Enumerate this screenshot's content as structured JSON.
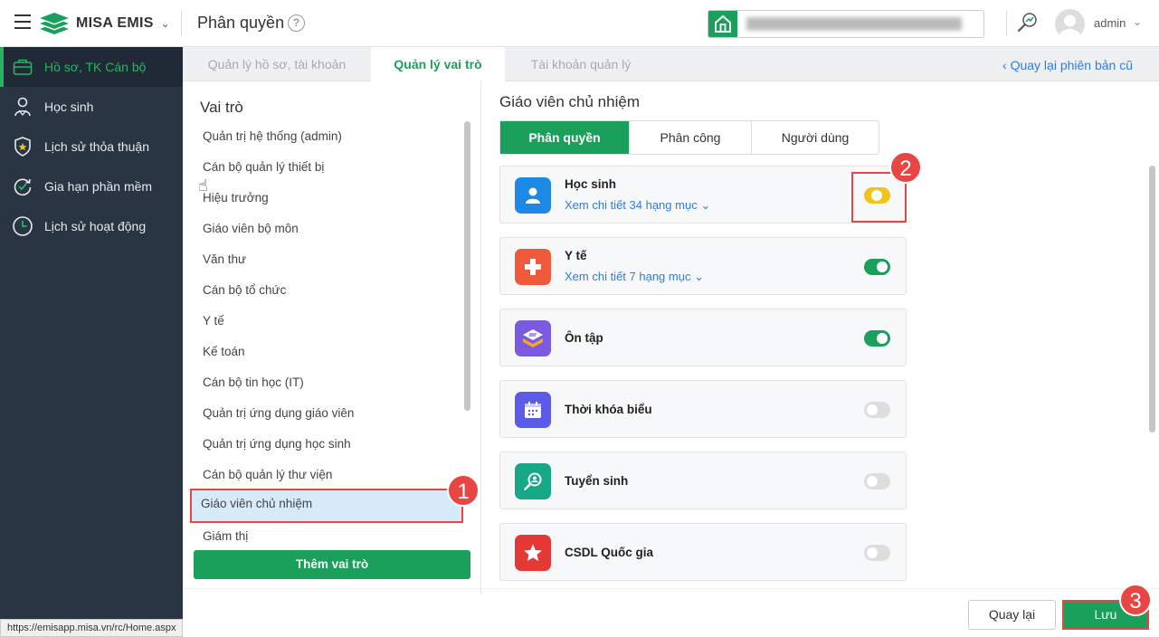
{
  "header": {
    "logo_text": "MISA EMIS",
    "page_title": "Phân quyền",
    "help": "?",
    "user_name": "admin"
  },
  "sidebar": {
    "items": [
      {
        "label": "Hồ sơ, TK Cán bộ",
        "icon": "briefcase-icon",
        "active": true
      },
      {
        "label": "Học sinh",
        "icon": "student-icon"
      },
      {
        "label": "Lịch sử thỏa thuận",
        "icon": "shield-star-icon"
      },
      {
        "label": "Gia hạn phần mềm",
        "icon": "renew-icon"
      },
      {
        "label": "Lịch sử hoạt động",
        "icon": "clock-icon"
      }
    ]
  },
  "tabs": [
    {
      "label": "Quản lý hồ sơ, tài khoản"
    },
    {
      "label": "Quản lý vai trò",
      "active": true
    },
    {
      "label": "Tài khoản quản lý"
    }
  ],
  "back_link": "‹ Quay lại phiên bản cũ",
  "roles": {
    "title": "Vai trò",
    "items": [
      "Quản trị hệ thống (admin)",
      "Cán bộ quản lý thiết bị",
      "Hiệu trưởng",
      "Giáo viên bộ môn",
      "Văn thư",
      "Cán bộ tổ chức",
      "Y tế",
      "Kế toán",
      "Cán bộ tin học (IT)",
      "Quản trị ứng dụng giáo viên",
      "Quản trị ứng dụng học sinh",
      "Cán bộ quản lý thư viện",
      "Giáo viên chủ nhiệm",
      "Giám thị"
    ],
    "selected": "Giáo viên chủ nhiệm",
    "add_button": "Thêm vai trò"
  },
  "permission": {
    "title": "Giáo viên chủ nhiệm",
    "segments": [
      "Phân quyền",
      "Phân công",
      "Người dùng"
    ],
    "active_segment": "Phân quyền",
    "modules": [
      {
        "name": "Học sinh",
        "detail": "Xem chi tiết 34 hạng mục",
        "state": "toggling",
        "icon": "person-icon",
        "color": "#1e88e5"
      },
      {
        "name": "Y tế",
        "detail": "Xem chi tiết 7 hạng mục",
        "state": "on",
        "icon": "medical-cross-icon",
        "color": "#ef5a3c"
      },
      {
        "name": "Ôn tập",
        "detail": "",
        "state": "on",
        "icon": "study-book-icon",
        "color": "#7a5ae0"
      },
      {
        "name": "Thời khóa biểu",
        "detail": "",
        "state": "off",
        "icon": "calendar-icon",
        "color": "#5b5be8"
      },
      {
        "name": "Tuyển sinh",
        "detail": "",
        "state": "off",
        "icon": "admission-search-icon",
        "color": "#18a888"
      },
      {
        "name": "CSDL Quốc gia",
        "detail": "",
        "state": "off",
        "icon": "star-icon",
        "color": "#e53935"
      }
    ]
  },
  "footer": {
    "back_button": "Quay lại",
    "save_button": "Lưu"
  },
  "badges": [
    "1",
    "2",
    "3"
  ],
  "status_url": "https://emisapp.misa.vn/rc/Home.aspx",
  "colors": {
    "brand_green": "#1aa05b",
    "sidebar_bg": "#2a3543",
    "highlight_red": "#e84545",
    "link_blue": "#2b7de9",
    "toggle_yellow": "#f0c419"
  }
}
